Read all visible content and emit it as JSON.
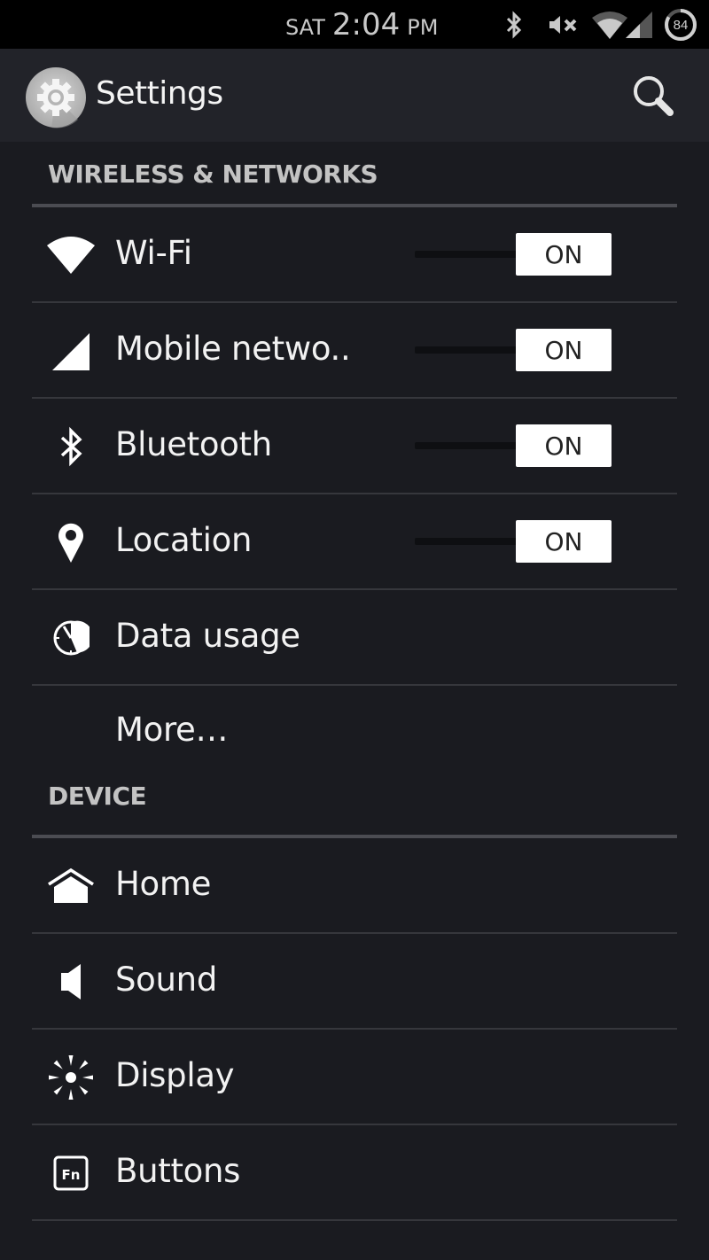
{
  "status_bar": {
    "day": "SAT",
    "time": "2:04",
    "ampm": "PM",
    "battery_level": "84",
    "battery_percent": 84,
    "icons": [
      "bluetooth-icon",
      "mute-icon",
      "wifi-icon",
      "signal-icon",
      "battery-icon"
    ]
  },
  "action_bar": {
    "title": "Settings",
    "app_icon": "settings-gear-icon",
    "search_icon": "search-icon"
  },
  "sections": [
    {
      "title": "WIRELESS & NETWORKS",
      "items": [
        {
          "label": "Wi-Fi",
          "icon": "wifi-icon",
          "toggle": "ON"
        },
        {
          "label": "Mobile netwo..",
          "icon": "signal-icon",
          "toggle": "ON"
        },
        {
          "label": "Bluetooth",
          "icon": "bluetooth-icon",
          "toggle": "ON"
        },
        {
          "label": "Location",
          "icon": "location-pin-icon",
          "toggle": "ON"
        },
        {
          "label": "Data usage",
          "icon": "data-usage-icon"
        },
        {
          "label": "More…",
          "icon": null
        }
      ]
    },
    {
      "title": "DEVICE",
      "items": [
        {
          "label": "Home",
          "icon": "home-icon"
        },
        {
          "label": "Sound",
          "icon": "speaker-icon"
        },
        {
          "label": "Display",
          "icon": "brightness-icon"
        },
        {
          "label": "Buttons",
          "icon": "fn-key-icon"
        }
      ]
    }
  ],
  "colors": {
    "background": "#1a1b20",
    "action_bar": "#222329",
    "status_bar": "#000000",
    "section_text": "#c3c3c3",
    "divider": "#36373c",
    "section_divider": "#4b4c52",
    "toggle_on": "#ffffff"
  }
}
